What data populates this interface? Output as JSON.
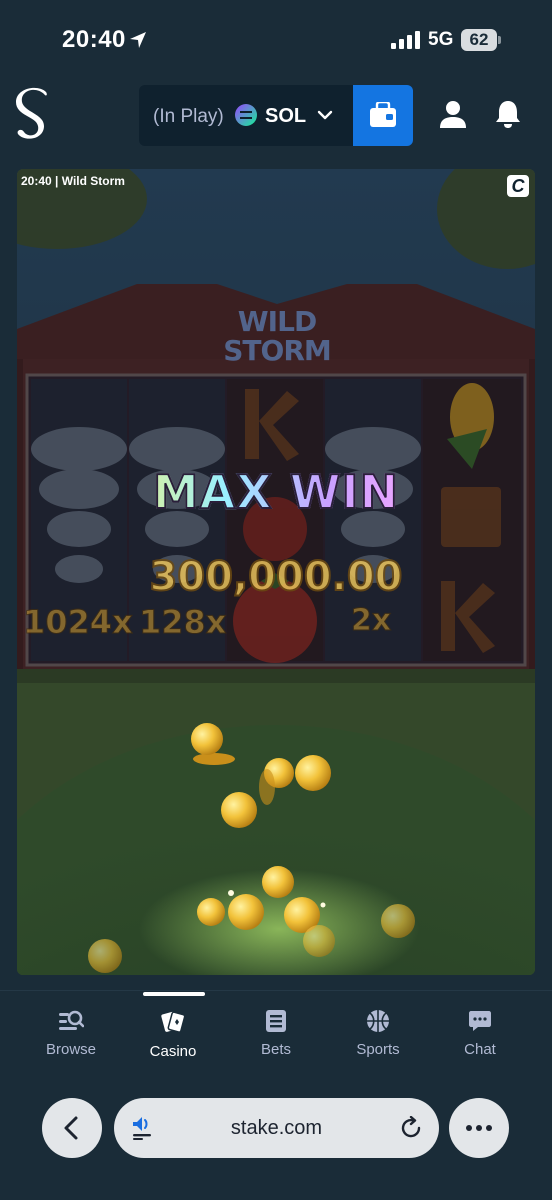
{
  "status_bar": {
    "time": "20:40",
    "network": "5G",
    "battery": "62"
  },
  "header": {
    "wallet_status": "(In Play)",
    "currency": "SOL",
    "icons": [
      "stake-logo-icon",
      "wallet-icon",
      "user-icon",
      "bell-icon"
    ],
    "accent_color": "#1475e1"
  },
  "game": {
    "caption": "20:40 | Wild Storm",
    "badge": "C",
    "logo_line1": "WILD",
    "logo_line2": "STORM",
    "headline": "MAX WIN",
    "win_amount": "300,000.00",
    "multipliers": [
      "1024x",
      "128x",
      "2x"
    ]
  },
  "bottom_nav": {
    "items": [
      {
        "label": "Browse",
        "icon": "browse-icon"
      },
      {
        "label": "Casino",
        "icon": "casino-cards-icon"
      },
      {
        "label": "Bets",
        "icon": "bets-list-icon"
      },
      {
        "label": "Sports",
        "icon": "basketball-icon"
      },
      {
        "label": "Chat",
        "icon": "chat-icon"
      }
    ],
    "active": "Casino"
  },
  "browser": {
    "url": "stake.com"
  }
}
